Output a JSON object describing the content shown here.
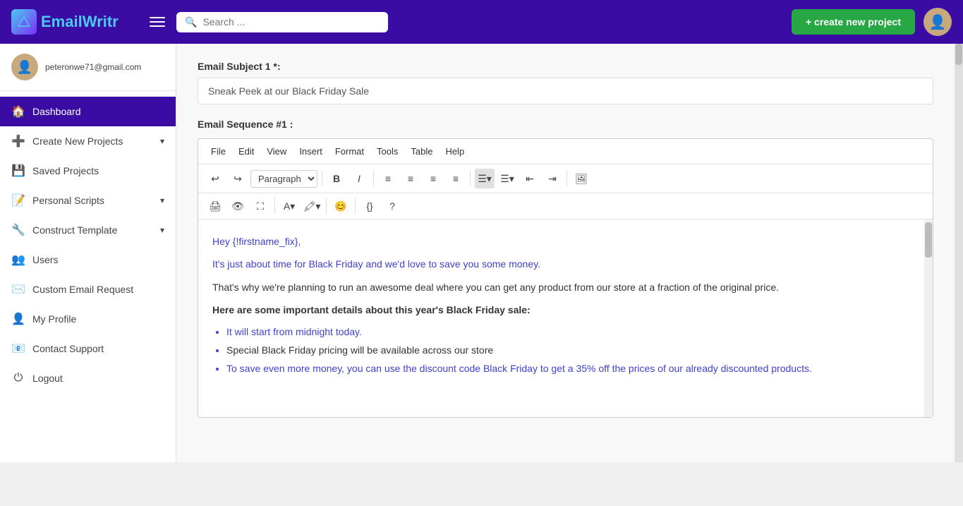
{
  "navbar": {
    "logo_text_1": "Email",
    "logo_text_2": "Writr",
    "hamburger_label": "menu",
    "search_placeholder": "Search ...",
    "create_btn_label": "+ create new project"
  },
  "sidebar": {
    "user_email": "peteronwe71@gmail.com",
    "nav_items": [
      {
        "id": "dashboard",
        "icon": "🏠",
        "label": "Dashboard",
        "active": true
      },
      {
        "id": "create-new-projects",
        "icon": "➕",
        "label": "Create New Projects",
        "arrow": "▾"
      },
      {
        "id": "saved-projects",
        "icon": "💾",
        "label": "Saved Projects"
      },
      {
        "id": "personal-scripts",
        "icon": "📝",
        "label": "Personal Scripts",
        "arrow": "▾"
      },
      {
        "id": "construct-template",
        "icon": "🔧",
        "label": "Construct Template",
        "arrow": "▾"
      },
      {
        "id": "users",
        "icon": "👥",
        "label": "Users"
      },
      {
        "id": "custom-email-request",
        "icon": "✉️",
        "label": "Custom Email Request"
      },
      {
        "id": "my-profile",
        "icon": "👤",
        "label": "My Profile"
      },
      {
        "id": "contact-support",
        "icon": "📧",
        "label": "Contact Support"
      },
      {
        "id": "logout",
        "icon": "⏻",
        "label": "Logout"
      }
    ]
  },
  "main": {
    "email_subject_label": "Email Subject 1 *:",
    "email_subject_value": "Sneak Peek at our Black Friday Sale",
    "sequence_label": "Email Sequence #1 :",
    "editor": {
      "menu_items": [
        "File",
        "Edit",
        "View",
        "Insert",
        "Format",
        "Tools",
        "Table",
        "Help"
      ],
      "toolbar_paragraph_label": "Paragraph",
      "content_lines": [
        "Hey {!firstname_fix},",
        "It's just about time for Black Friday and we'd love to save you some money.",
        "That's why we're planning to run an awesome deal where you can get any product from our store at a fraction of the original price.",
        "Here are some important details about this year's Black Friday sale:",
        "It will start from midnight today.",
        "Special Black Friday pricing will be available across our store",
        "To save even more money, you can use the discount code Black Friday to get a 35% off the prices of our already discounted products."
      ]
    }
  }
}
